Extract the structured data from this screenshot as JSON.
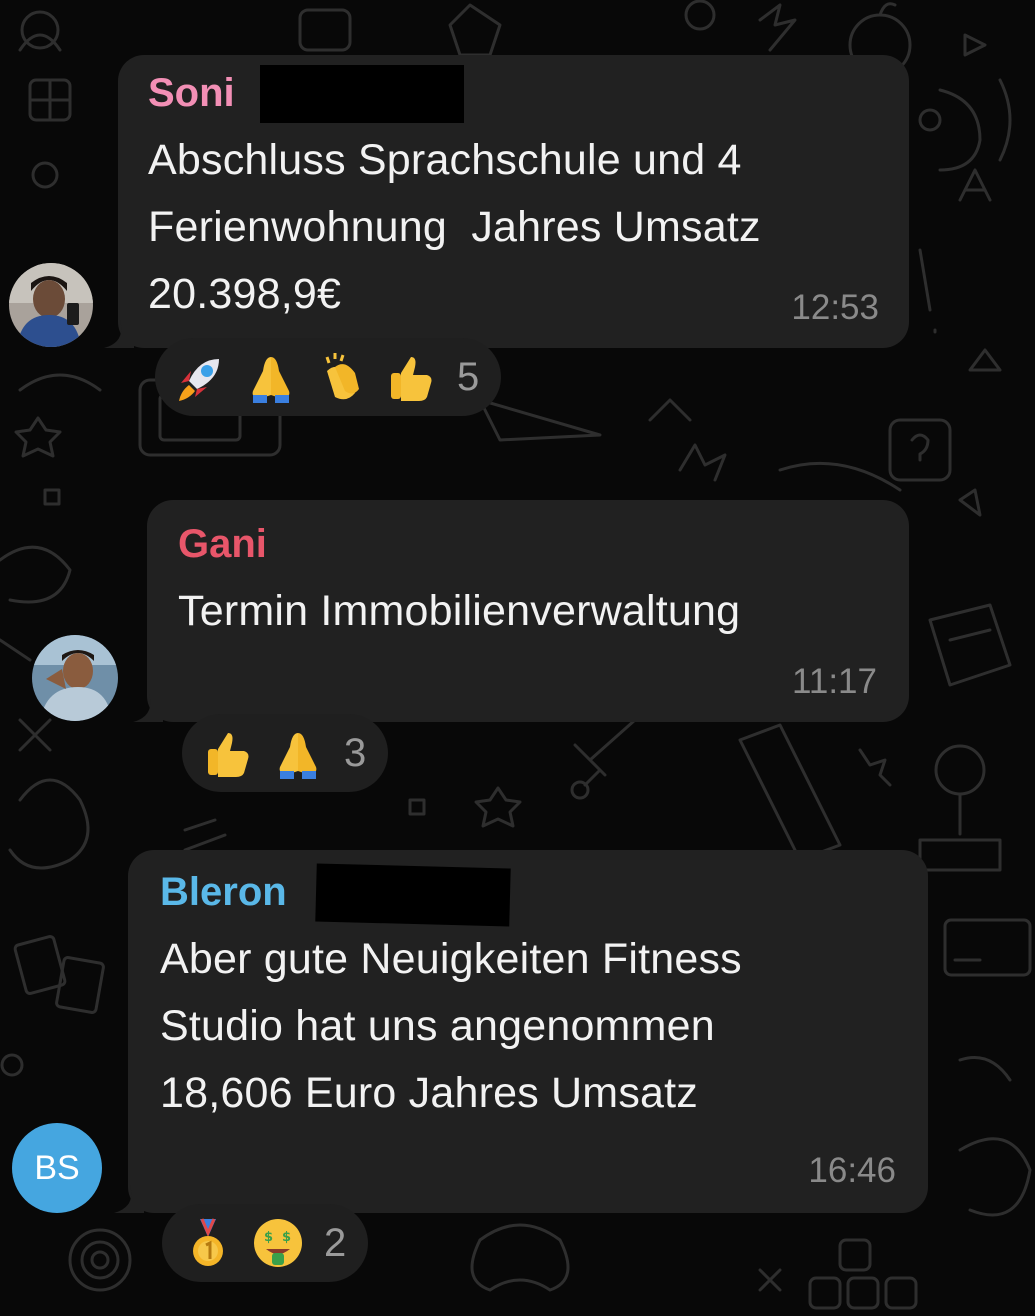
{
  "messages": [
    {
      "sender": "Soni",
      "sender_color": "#f28fb5",
      "text": "Abschluss Sprachschule und 4\nFerienwohnung  Jahres Umsatz\n20.398,9€",
      "time": "12:53",
      "avatar": "photo",
      "reactions": [
        "rocket-emoji",
        "folded-hands-emoji",
        "clapping-hands-emoji",
        "thumbs-up-emoji"
      ],
      "reaction_count": "5"
    },
    {
      "sender": "Gani",
      "sender_color": "#e8566a",
      "text": "Termin Immobilienverwaltung",
      "time": "11:17",
      "avatar": "photo",
      "reactions": [
        "thumbs-up-emoji",
        "folded-hands-emoji"
      ],
      "reaction_count": "3"
    },
    {
      "sender": "Bleron",
      "sender_color": "#5ab8e8",
      "text": "Aber gute Neuigkeiten Fitness\nStudio hat uns angenommen\n18,606 Euro Jahres Umsatz",
      "time": "16:46",
      "avatar_initials": "BS",
      "avatar_color": "#45a6e0",
      "reactions": [
        "first-place-medal-emoji",
        "money-mouth-face-emoji"
      ],
      "reaction_count": "2"
    }
  ]
}
